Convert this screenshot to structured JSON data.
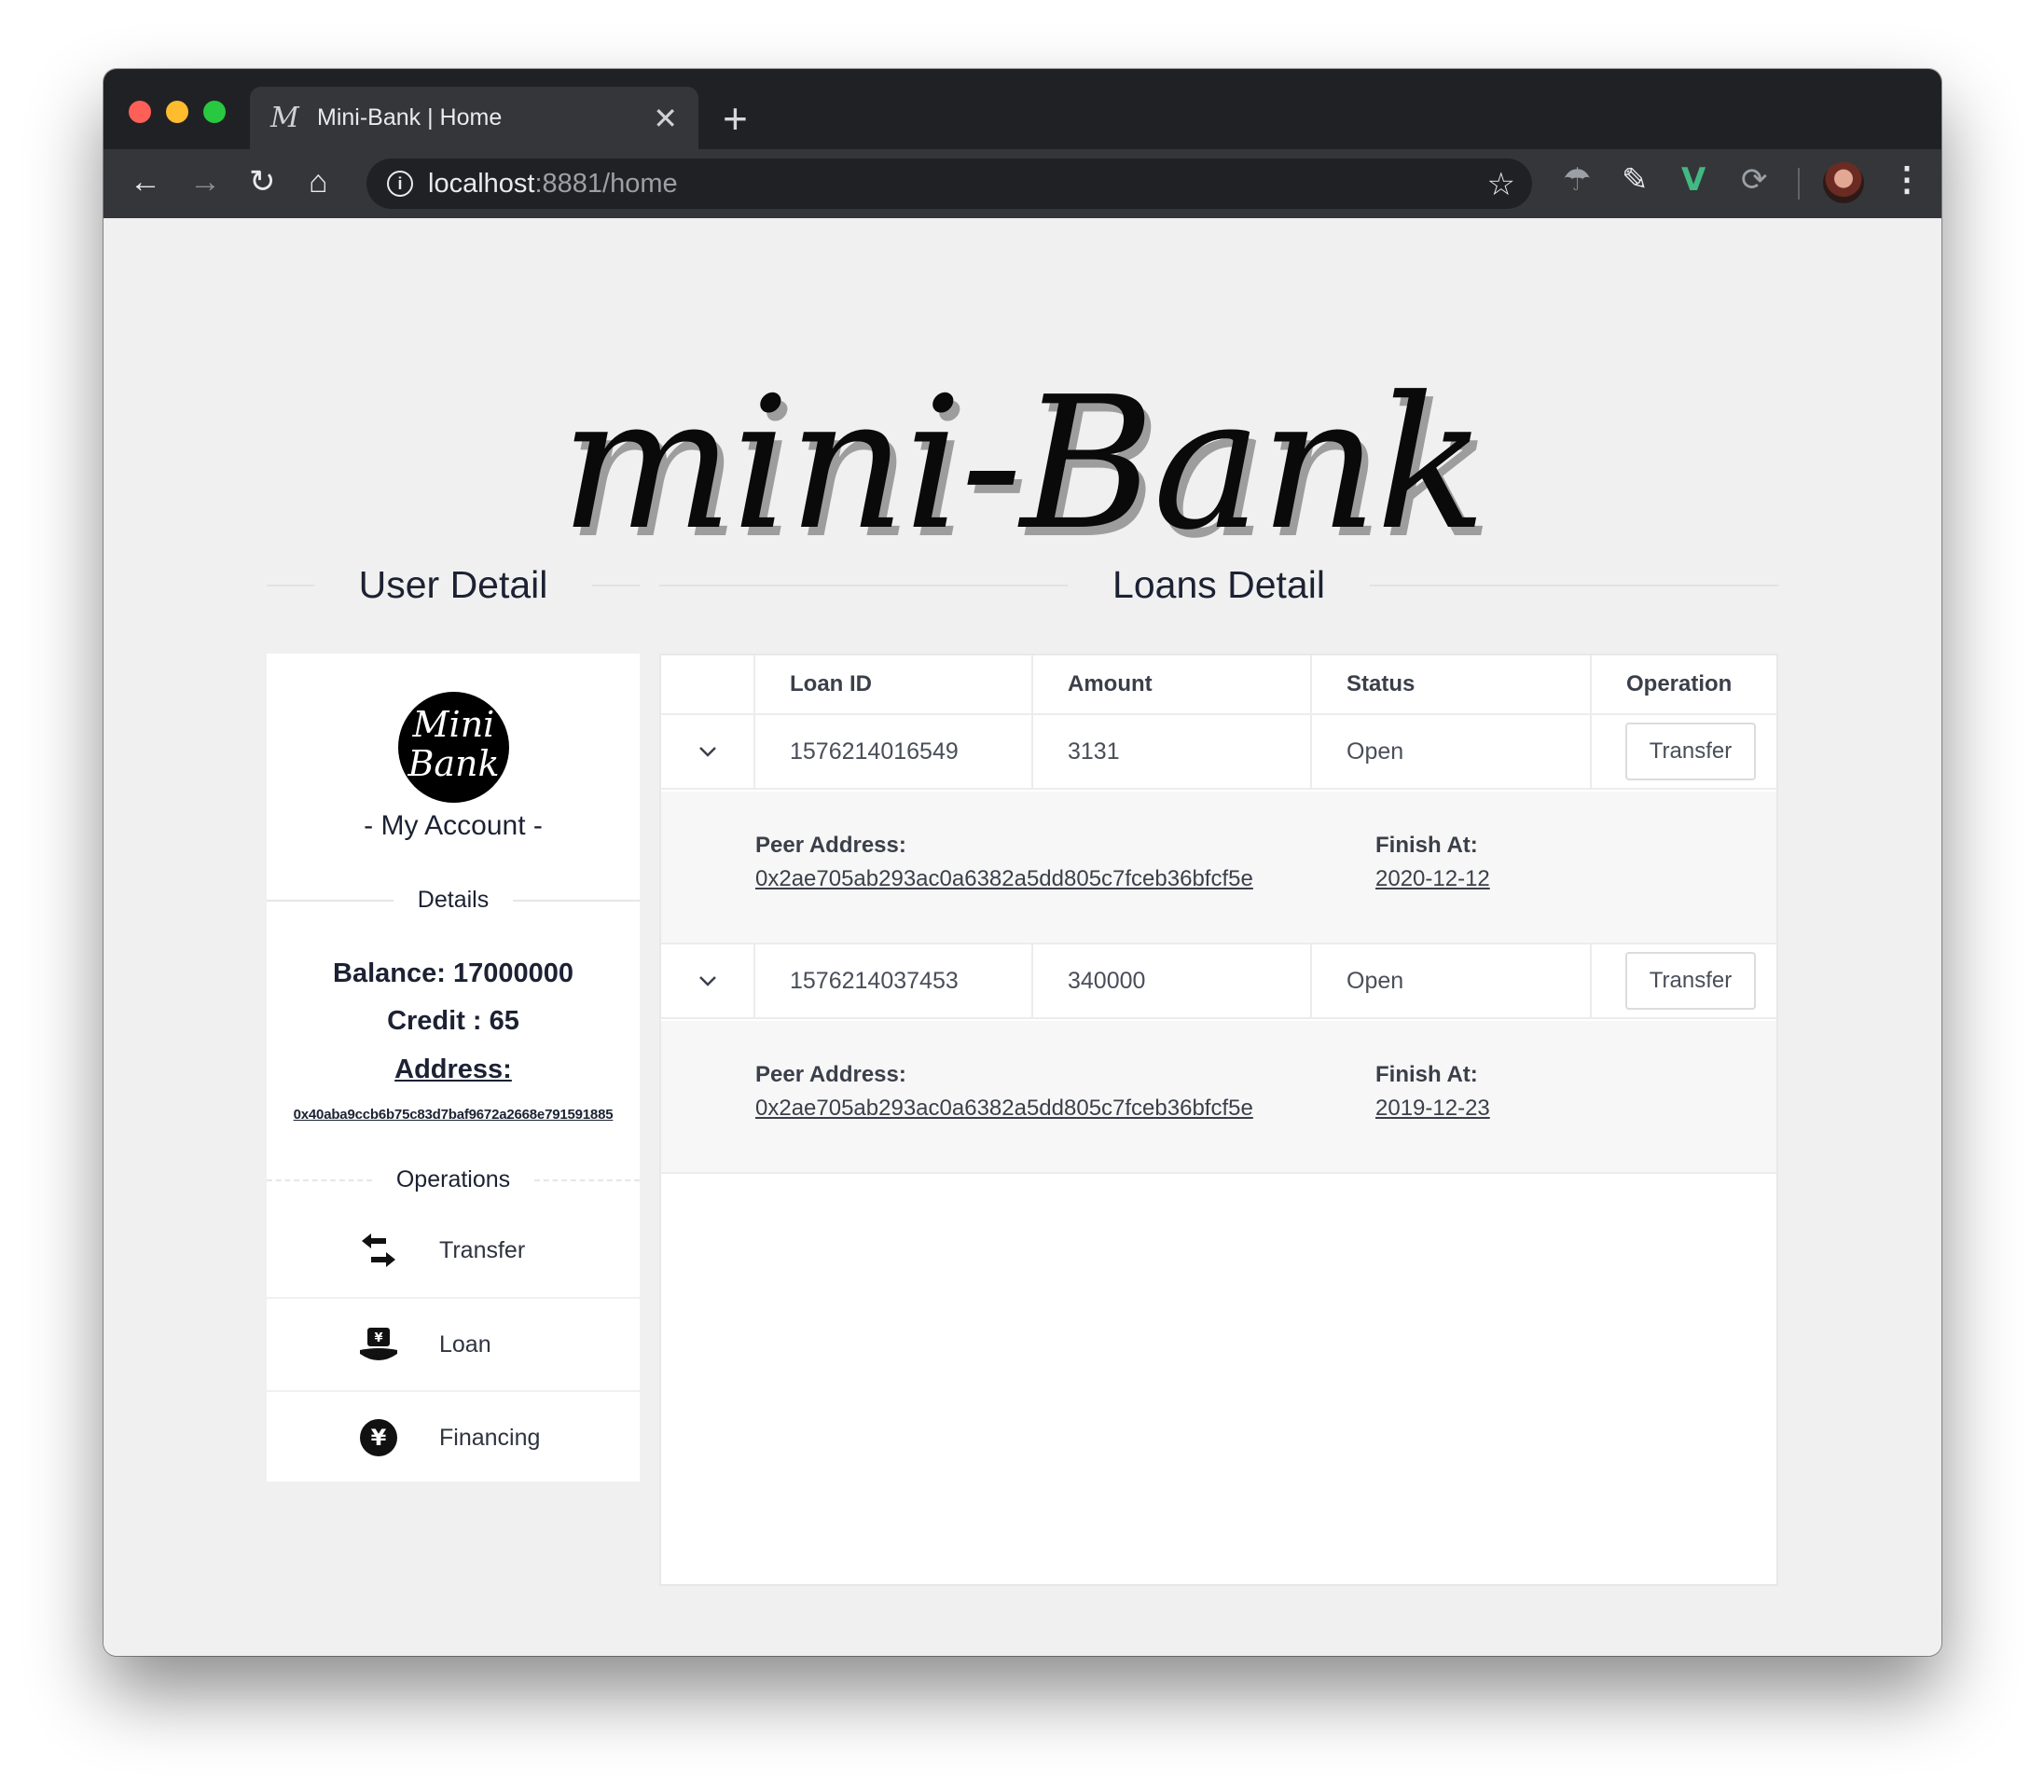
{
  "browser": {
    "tab_title": "Mini-Bank | Home",
    "tab_favicon": "M",
    "url_host": "localhost",
    "url_rest": ":8881/home"
  },
  "page": {
    "logo_text": "mini-Bank",
    "user_section_title": "User Detail",
    "loans_section_title": "Loans Detail"
  },
  "user": {
    "brand_line1": "Mini",
    "brand_line2": "Bank",
    "account_heading": "- My Account -",
    "details_heading": "Details",
    "balance_text": "Balance: 17000000",
    "credit_text": "Credit : 65",
    "address_label": "Address:",
    "address_value": "0x40aba9ccb6b75c83d7baf9672a2668e791591885",
    "operations_heading": "Operations",
    "operations": [
      {
        "label": "Transfer",
        "icon": "transfer-arrows-icon"
      },
      {
        "label": "Loan",
        "icon": "loan-bag-icon"
      },
      {
        "label": "Financing",
        "icon": "yen-circle-icon"
      }
    ]
  },
  "loans": {
    "columns": [
      "",
      "Loan ID",
      "Amount",
      "Status",
      "Operation"
    ],
    "rows": [
      {
        "loan_id": "1576214016549",
        "amount": "3131",
        "status": "Open",
        "action": "Transfer",
        "peer_label": "Peer Address:",
        "peer_address": "0x2ae705ab293ac0a6382a5dd805c7fceb36bfcf5e",
        "finish_label": "Finish At:",
        "finish_at": "2020-12-12"
      },
      {
        "loan_id": "1576214037453",
        "amount": "340000",
        "status": "Open",
        "action": "Transfer",
        "peer_label": "Peer Address:",
        "peer_address": "0x2ae705ab293ac0a6382a5dd805c7fceb36bfcf5e",
        "finish_label": "Finish At:",
        "finish_at": "2019-12-23"
      }
    ]
  }
}
